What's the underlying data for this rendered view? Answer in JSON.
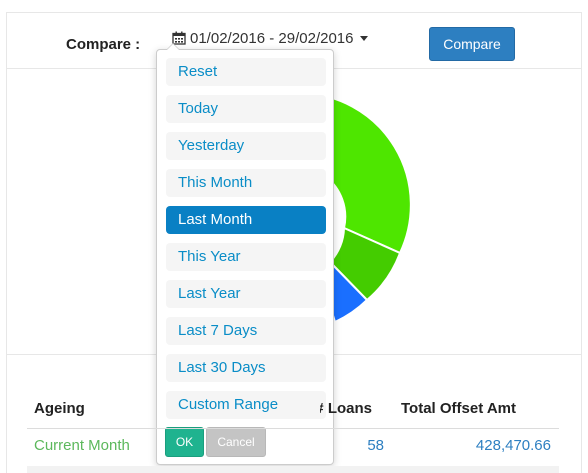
{
  "compare": {
    "label": "Compare :",
    "date_range": "01/02/2016 - 29/02/2016",
    "button_label": "Compare"
  },
  "date_picker": {
    "ranges": [
      {
        "label": "Reset",
        "active": false
      },
      {
        "label": "Today",
        "active": false
      },
      {
        "label": "Yesterday",
        "active": false
      },
      {
        "label": "This Month",
        "active": false
      },
      {
        "label": "Last Month",
        "active": true
      },
      {
        "label": "This Year",
        "active": false
      },
      {
        "label": "Last Year",
        "active": false
      },
      {
        "label": "Last 7 Days",
        "active": false
      },
      {
        "label": "Last 30 Days",
        "active": false
      },
      {
        "label": "Custom Range",
        "active": false
      }
    ],
    "ok_label": "OK",
    "cancel_label": "Cancel"
  },
  "chart": {
    "type": "donut",
    "visible_segment_colors": [
      "#4ee600",
      "#44cc00",
      "#1a6fff"
    ]
  },
  "table": {
    "headers": {
      "ageing": "Ageing",
      "loans": "Loans #",
      "offset": "Total Offset Amt"
    },
    "rows": [
      {
        "ageing": "Current Month",
        "loans": "58",
        "offset": "428,470.66"
      }
    ]
  },
  "colors": {
    "accent_blue": "#2d7fc1",
    "range_link": "#0a8dc7",
    "active_range": "#0980c4",
    "ok_green": "#1fb38f",
    "current_month_green": "#5cb85c"
  }
}
